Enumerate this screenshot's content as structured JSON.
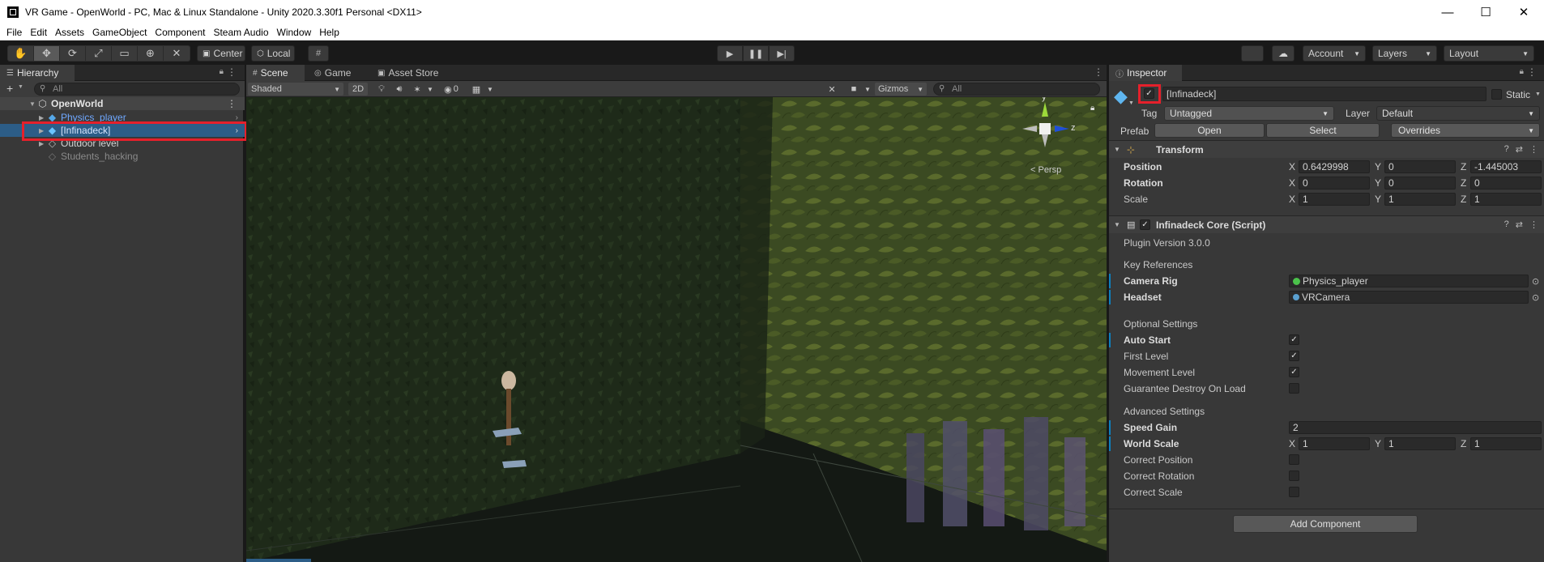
{
  "window": {
    "title": "VR Game - OpenWorld - PC, Mac & Linux Standalone - Unity 2020.3.30f1 Personal <DX11>",
    "minimize": "—",
    "maximize": "☐",
    "close": "✕"
  },
  "menu": [
    "File",
    "Edit",
    "Assets",
    "GameObject",
    "Component",
    "Steam Audio",
    "Window",
    "Help"
  ],
  "toolbar": {
    "pivot_center": "Center",
    "pivot_local": "Local",
    "account": "Account",
    "layers": "Layers",
    "layout": "Layout"
  },
  "hierarchy": {
    "tab": "Hierarchy",
    "search_placeholder": "All",
    "add": "+",
    "scene": "OpenWorld",
    "items": [
      {
        "name": "Physics_player",
        "color": "#6fa8ff"
      },
      {
        "name": "[Infinadeck]",
        "color": "#d6e6ff"
      },
      {
        "name": "Outdoor level",
        "color": "#d2d2d2"
      },
      {
        "name": "Students_hacking",
        "color": "#8a8a8a"
      }
    ]
  },
  "scene": {
    "tabs": [
      "Scene",
      "Game",
      "Asset Store"
    ],
    "shading": "Shaded",
    "mode_2d": "2D",
    "hidden_count": "0",
    "gizmos": "Gizmos",
    "search_placeholder": "All",
    "persp": "< Persp",
    "axis_y": "y",
    "axis_z": "z"
  },
  "inspector": {
    "tab": "Inspector",
    "object_name": "[Infinadeck]",
    "static_label": "Static",
    "tag_label": "Tag",
    "tag_value": "Untagged",
    "layer_label": "Layer",
    "layer_value": "Default",
    "prefab_label": "Prefab",
    "prefab_open": "Open",
    "prefab_select": "Select",
    "prefab_overrides": "Overrides",
    "transform": {
      "title": "Transform",
      "position_label": "Position",
      "position": [
        "0.6429998",
        "0",
        "-1.445003"
      ],
      "rotation_label": "Rotation",
      "rotation": [
        "0",
        "0",
        "0"
      ],
      "scale_label": "Scale",
      "scale": [
        "1",
        "1",
        "1"
      ]
    },
    "script": {
      "title": "Infinadeck Core (Script)",
      "plugin_version": "Plugin Version 3.0.0",
      "key_refs_header": "Key References",
      "camera_rig_label": "Camera Rig",
      "camera_rig_value": "Physics_player",
      "headset_label": "Headset",
      "headset_value": "VRCamera",
      "optional_header": "Optional Settings",
      "auto_start": "Auto Start",
      "first_level": "First Level",
      "movement_level": "Movement Level",
      "guarantee_destroy": "Guarantee Destroy On Load",
      "advanced_header": "Advanced Settings",
      "speed_gain_label": "Speed Gain",
      "speed_gain": "2",
      "world_scale_label": "World Scale",
      "world_scale": [
        "1",
        "1",
        "1"
      ],
      "correct_position": "Correct Position",
      "correct_rotation": "Correct Rotation",
      "correct_scale": "Correct Scale"
    },
    "add_component": "Add Component",
    "axis_x": "X",
    "axis_y": "Y",
    "axis_z": "Z"
  }
}
